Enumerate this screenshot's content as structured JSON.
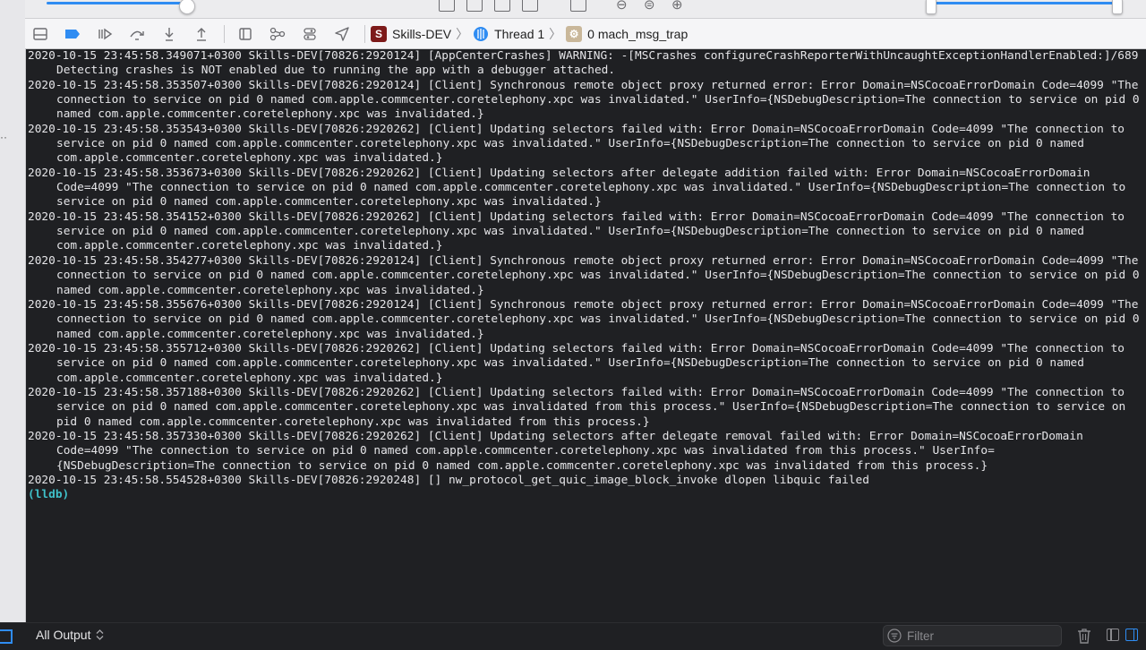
{
  "toolbar": {
    "breadcrumb": [
      {
        "label": "Skills-DEV",
        "icon": "app-icon",
        "badge": "S"
      },
      {
        "label": "Thread 1",
        "icon": "thread-icon"
      },
      {
        "label": "0 mach_msg_trap",
        "icon": "gear-icon"
      }
    ]
  },
  "console": {
    "lines": [
      "2020-10-15 23:45:58.349071+0300 Skills-DEV[70826:2920124] [AppCenterCrashes] WARNING: -[MSCrashes configureCrashReporterWithUncaughtExceptionHandlerEnabled:]/689 Detecting crashes is NOT enabled due to running the app with a debugger attached.",
      "2020-10-15 23:45:58.353507+0300 Skills-DEV[70826:2920124] [Client] Synchronous remote object proxy returned error: Error Domain=NSCocoaErrorDomain Code=4099 \"The connection to service on pid 0 named com.apple.commcenter.coretelephony.xpc was invalidated.\" UserInfo={NSDebugDescription=The connection to service on pid 0 named com.apple.commcenter.coretelephony.xpc was invalidated.}",
      "2020-10-15 23:45:58.353543+0300 Skills-DEV[70826:2920262] [Client] Updating selectors failed with: Error Domain=NSCocoaErrorDomain Code=4099 \"The connection to service on pid 0 named com.apple.commcenter.coretelephony.xpc was invalidated.\" UserInfo={NSDebugDescription=The connection to service on pid 0 named com.apple.commcenter.coretelephony.xpc was invalidated.}",
      "2020-10-15 23:45:58.353673+0300 Skills-DEV[70826:2920262] [Client] Updating selectors after delegate addition failed with: Error Domain=NSCocoaErrorDomain Code=4099 \"The connection to service on pid 0 named com.apple.commcenter.coretelephony.xpc was invalidated.\" UserInfo={NSDebugDescription=The connection to service on pid 0 named com.apple.commcenter.coretelephony.xpc was invalidated.}",
      "2020-10-15 23:45:58.354152+0300 Skills-DEV[70826:2920262] [Client] Updating selectors failed with: Error Domain=NSCocoaErrorDomain Code=4099 \"The connection to service on pid 0 named com.apple.commcenter.coretelephony.xpc was invalidated.\" UserInfo={NSDebugDescription=The connection to service on pid 0 named com.apple.commcenter.coretelephony.xpc was invalidated.}",
      "2020-10-15 23:45:58.354277+0300 Skills-DEV[70826:2920124] [Client] Synchronous remote object proxy returned error: Error Domain=NSCocoaErrorDomain Code=4099 \"The connection to service on pid 0 named com.apple.commcenter.coretelephony.xpc was invalidated.\" UserInfo={NSDebugDescription=The connection to service on pid 0 named com.apple.commcenter.coretelephony.xpc was invalidated.}",
      "2020-10-15 23:45:58.355676+0300 Skills-DEV[70826:2920124] [Client] Synchronous remote object proxy returned error: Error Domain=NSCocoaErrorDomain Code=4099 \"The connection to service on pid 0 named com.apple.commcenter.coretelephony.xpc was invalidated.\" UserInfo={NSDebugDescription=The connection to service on pid 0 named com.apple.commcenter.coretelephony.xpc was invalidated.}",
      "2020-10-15 23:45:58.355712+0300 Skills-DEV[70826:2920262] [Client] Updating selectors failed with: Error Domain=NSCocoaErrorDomain Code=4099 \"The connection to service on pid 0 named com.apple.commcenter.coretelephony.xpc was invalidated.\" UserInfo={NSDebugDescription=The connection to service on pid 0 named com.apple.commcenter.coretelephony.xpc was invalidated.}",
      "2020-10-15 23:45:58.357188+0300 Skills-DEV[70826:2920262] [Client] Updating selectors failed with: Error Domain=NSCocoaErrorDomain Code=4099 \"The connection to service on pid 0 named com.apple.commcenter.coretelephony.xpc was invalidated from this process.\" UserInfo={NSDebugDescription=The connection to service on pid 0 named com.apple.commcenter.coretelephony.xpc was invalidated from this process.}",
      "2020-10-15 23:45:58.357330+0300 Skills-DEV[70826:2920262] [Client] Updating selectors after delegate removal failed with: Error Domain=NSCocoaErrorDomain Code=4099 \"The connection to service on pid 0 named com.apple.commcenter.coretelephony.xpc was invalidated from this process.\" UserInfo={NSDebugDescription=The connection to service on pid 0 named com.apple.commcenter.coretelephony.xpc was invalidated from this process.}",
      "2020-10-15 23:45:58.554528+0300 Skills-DEV[70826:2920248] [] nw_protocol_get_quic_image_block_invoke dlopen libquic failed"
    ],
    "prompt": "(lldb)"
  },
  "footer": {
    "output_selector": "All Output",
    "filter_placeholder": "Filter"
  },
  "colors": {
    "accent": "#2f8cf2",
    "console_bg": "#1f2023",
    "prompt": "#3fc0c9",
    "app_badge": "#7d1a1a"
  }
}
